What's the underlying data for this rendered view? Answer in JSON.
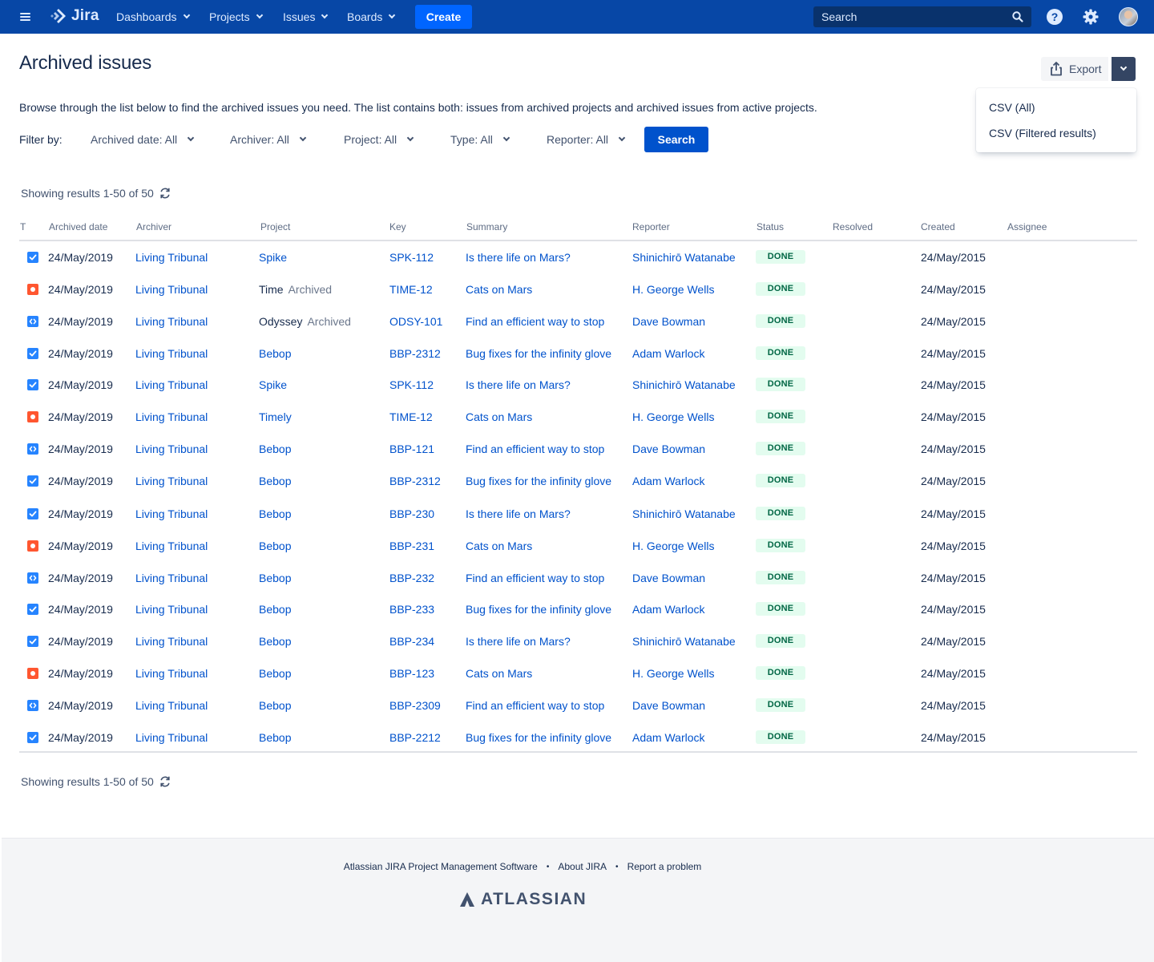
{
  "nav": {
    "product": "Jira",
    "items": [
      "Dashboards",
      "Projects",
      "Issues",
      "Boards"
    ],
    "create_label": "Create",
    "search_placeholder": "Search",
    "help_glyph": "?",
    "menu_icon": "hamburger-icon",
    "logo_icon": "jira-logo-icon"
  },
  "page": {
    "title": "Archived issues",
    "description": "Browse through the list below to find the archived issues you need. The list contains both: issues from archived projects and archived issues from active projects."
  },
  "export": {
    "label": "Export",
    "menu": [
      "CSV (All)",
      "CSV (Filtered results)"
    ]
  },
  "filters": {
    "label": "Filter by:",
    "items": [
      "Archived date: All",
      "Archiver: All",
      "Project: All",
      "Type: All",
      "Reporter: All"
    ],
    "search_label": "Search"
  },
  "results": {
    "summary_top": "Showing results 1-50 of 50",
    "summary_bottom": "Showing results 1-50 of 50"
  },
  "table": {
    "columns": [
      "T",
      "Archived date",
      "Archiver",
      "Project",
      "Key",
      "Summary",
      "Reporter",
      "Status",
      "Resolved",
      "Created",
      "Assignee"
    ],
    "rows": [
      {
        "type": "story",
        "archived_date": "24/May/2019",
        "archiver": "Living Tribunal",
        "project": "Spike",
        "project_archived": "",
        "key": "SPK-112",
        "summary": "Is there life on Mars?",
        "reporter": "Shinichirō Watanabe",
        "status": "DONE",
        "resolved": "",
        "created": "24/May/2015",
        "assignee": ""
      },
      {
        "type": "bug",
        "archived_date": "24/May/2019",
        "archiver": "Living Tribunal",
        "project": "Time",
        "project_archived": "Archived",
        "key": "TIME-12",
        "summary": "Cats on Mars",
        "reporter": "H. George Wells",
        "status": "DONE",
        "resolved": "",
        "created": "24/May/2015",
        "assignee": ""
      },
      {
        "type": "task",
        "archived_date": "24/May/2019",
        "archiver": "Living Tribunal",
        "project": "Odyssey",
        "project_archived": "Archived",
        "key": "ODSY-101",
        "summary": "Find an efficient way to stop",
        "reporter": "Dave Bowman",
        "status": "DONE",
        "resolved": "",
        "created": "24/May/2015",
        "assignee": ""
      },
      {
        "type": "story",
        "archived_date": "24/May/2019",
        "archiver": "Living Tribunal",
        "project": "Bebop",
        "project_archived": "",
        "key": "BBP-2312",
        "summary": "Bug fixes for the infinity glove",
        "reporter": "Adam Warlock",
        "status": "DONE",
        "resolved": "",
        "created": "24/May/2015",
        "assignee": ""
      },
      {
        "type": "story",
        "archived_date": "24/May/2019",
        "archiver": "Living Tribunal",
        "project": "Spike",
        "project_archived": "",
        "key": "SPK-112",
        "summary": "Is there life on Mars?",
        "reporter": "Shinichirō Watanabe",
        "status": "DONE",
        "resolved": "",
        "created": "24/May/2015",
        "assignee": ""
      },
      {
        "type": "bug",
        "archived_date": "24/May/2019",
        "archiver": "Living Tribunal",
        "project": "Timely",
        "project_archived": "",
        "key": "TIME-12",
        "summary": "Cats on Mars",
        "reporter": "H. George Wells",
        "status": "DONE",
        "resolved": "",
        "created": "24/May/2015",
        "assignee": ""
      },
      {
        "type": "task",
        "archived_date": "24/May/2019",
        "archiver": "Living Tribunal",
        "project": "Bebop",
        "project_archived": "",
        "key": "BBP-121",
        "summary": "Find an efficient way to stop",
        "reporter": "Dave Bowman",
        "status": "DONE",
        "resolved": "",
        "created": "24/May/2015",
        "assignee": ""
      },
      {
        "type": "story",
        "archived_date": "24/May/2019",
        "archiver": "Living Tribunal",
        "project": "Bebop",
        "project_archived": "",
        "key": "BBP-2312",
        "summary": "Bug fixes for the infinity glove",
        "reporter": "Adam Warlock",
        "status": "DONE",
        "resolved": "",
        "created": "24/May/2015",
        "assignee": ""
      },
      {
        "type": "story",
        "archived_date": "24/May/2019",
        "archiver": "Living Tribunal",
        "project": "Bebop",
        "project_archived": "",
        "key": "BBP-230",
        "summary": "Is there life on Mars?",
        "reporter": "Shinichirō Watanabe",
        "status": "DONE",
        "resolved": "",
        "created": "24/May/2015",
        "assignee": ""
      },
      {
        "type": "bug",
        "archived_date": "24/May/2019",
        "archiver": "Living Tribunal",
        "project": "Bebop",
        "project_archived": "",
        "key": "BBP-231",
        "summary": "Cats on Mars",
        "reporter": "H. George Wells",
        "status": "DONE",
        "resolved": "",
        "created": "24/May/2015",
        "assignee": ""
      },
      {
        "type": "task",
        "archived_date": "24/May/2019",
        "archiver": "Living Tribunal",
        "project": "Bebop",
        "project_archived": "",
        "key": "BBP-232",
        "summary": "Find an efficient way to stop",
        "reporter": "Dave Bowman",
        "status": "DONE",
        "resolved": "",
        "created": "24/May/2015",
        "assignee": ""
      },
      {
        "type": "story",
        "archived_date": "24/May/2019",
        "archiver": "Living Tribunal",
        "project": "Bebop",
        "project_archived": "",
        "key": "BBP-233",
        "summary": "Bug fixes for the infinity glove",
        "reporter": "Adam Warlock",
        "status": "DONE",
        "resolved": "",
        "created": "24/May/2015",
        "assignee": ""
      },
      {
        "type": "story",
        "archived_date": "24/May/2019",
        "archiver": "Living Tribunal",
        "project": "Bebop",
        "project_archived": "",
        "key": "BBP-234",
        "summary": "Is there life on Mars?",
        "reporter": "Shinichirō Watanabe",
        "status": "DONE",
        "resolved": "",
        "created": "24/May/2015",
        "assignee": ""
      },
      {
        "type": "bug",
        "archived_date": "24/May/2019",
        "archiver": "Living Tribunal",
        "project": "Bebop",
        "project_archived": "",
        "key": "BBP-123",
        "summary": "Cats on Mars",
        "reporter": "H. George Wells",
        "status": "DONE",
        "resolved": "",
        "created": "24/May/2015",
        "assignee": ""
      },
      {
        "type": "task",
        "archived_date": "24/May/2019",
        "archiver": "Living Tribunal",
        "project": "Bebop",
        "project_archived": "",
        "key": "BBP-2309",
        "summary": "Find an efficient way to stop",
        "reporter": "Dave Bowman",
        "status": "DONE",
        "resolved": "",
        "created": "24/May/2015",
        "assignee": ""
      },
      {
        "type": "story",
        "archived_date": "24/May/2019",
        "archiver": "Living Tribunal",
        "project": "Bebop",
        "project_archived": "",
        "key": "BBP-2212",
        "summary": "Bug fixes for the infinity glove",
        "reporter": "Adam Warlock",
        "status": "DONE",
        "resolved": "",
        "created": "24/May/2015",
        "assignee": ""
      }
    ]
  },
  "footer": {
    "links": [
      "Atlassian JIRA Project Management Software",
      "About JIRA",
      "Report a problem"
    ],
    "separator": "•",
    "logo_text": "ATLASSIAN"
  },
  "colors": {
    "nav_bg": "#0747a6",
    "create_bg": "#0065ff",
    "primary": "#0052cc",
    "link": "#0052cc",
    "done_bg": "#e3fcef",
    "done_text": "#006644",
    "bug": "#ff5630",
    "story": "#2684ff",
    "footer_bg": "#f4f5f7"
  }
}
